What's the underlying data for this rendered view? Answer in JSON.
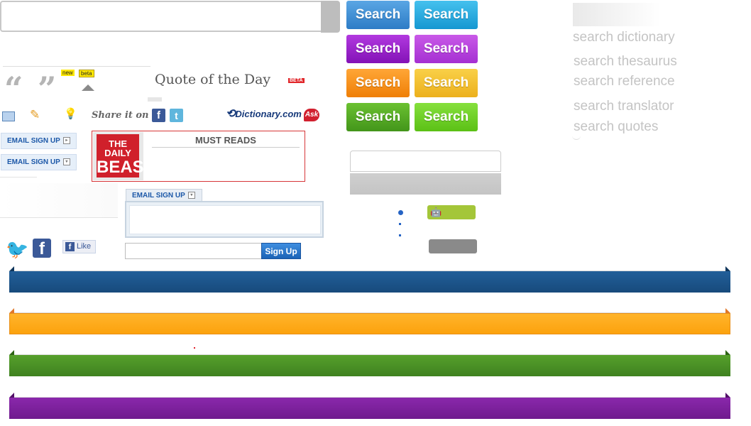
{
  "quote_widget": {
    "tag_new": "new",
    "tag_beta": "beta",
    "title": "Quote of the Day",
    "beta_badge": "BETA"
  },
  "share": {
    "label": "Share it on",
    "facebook_glyph": "f",
    "twitter_glyph": "t",
    "dictionary_logo": "Dictionary.com",
    "ask_logo": "Ask"
  },
  "email_signup": {
    "pill_1": "EMAIL SIGN UP",
    "pill_2": "EMAIL SIGN UP",
    "tab_label": "EMAIL SIGN UP",
    "button": "Sign Up"
  },
  "must_reads": {
    "logo_line1": "THE DAILY",
    "logo_line2": "BEAST",
    "title": "MUST READS"
  },
  "social": {
    "like_label": "Like",
    "fb_glyph": "f"
  },
  "search_buttons": [
    {
      "label": "Search",
      "color": "#3b8fd4"
    },
    {
      "label": "Search",
      "color": "#22a8dd"
    },
    {
      "label": "Search",
      "color": "#9a1cc8"
    },
    {
      "label": "Search",
      "color": "#b53ddd"
    },
    {
      "label": "Search",
      "color": "#f98d12"
    },
    {
      "label": "Search",
      "color": "#f2bd24"
    },
    {
      "label": "Search",
      "color": "#52a81c"
    },
    {
      "label": "Search",
      "color": "#6fcf1e"
    }
  ],
  "search_links": [
    "search dictionary",
    "search thesaurus",
    "search reference",
    "search translator",
    "search quotes"
  ],
  "ribbons": [
    {
      "color": "#1b5187",
      "tail": "#0f355b"
    },
    {
      "color": "#fdaa19",
      "tail": "#e0782a"
    },
    {
      "color": "#4a8e24",
      "tail": "#2e6415"
    },
    {
      "color": "#7b1e9a",
      "tail": "#531069"
    }
  ],
  "icons": {
    "pencil": "✎",
    "bulb": "💡",
    "bird": "🐦",
    "apple": "",
    "android": "🤖"
  }
}
